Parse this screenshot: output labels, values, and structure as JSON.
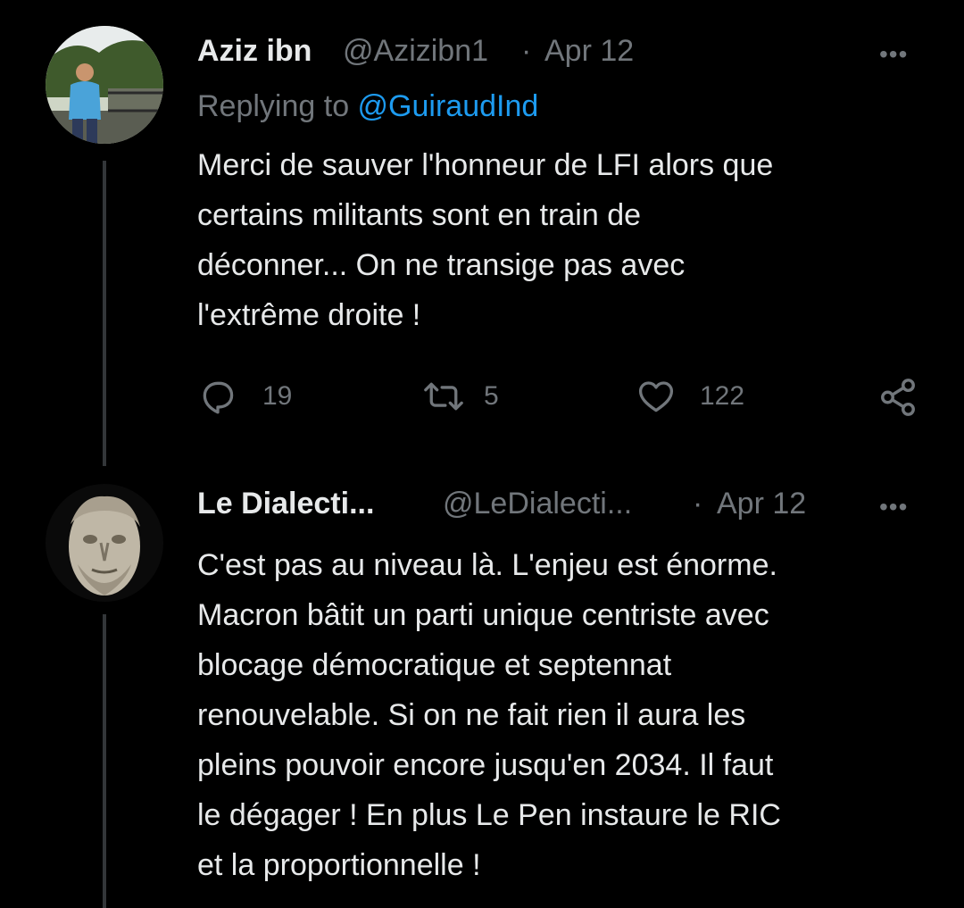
{
  "tweets": [
    {
      "name": "Aziz ibn",
      "handle": "@Azizibn1",
      "separator": "·",
      "date": "Apr 12",
      "more": "•••",
      "replying_prefix": "Replying to ",
      "replying_to": "@GuiraudInd",
      "text_lines": [
        "Merci de sauver l'honneur de LFI alors que",
        "certains militants sont en train de",
        "déconner... On ne transige pas avec",
        "l'extrême droite !"
      ],
      "actions": {
        "reply_icon": "reply-icon",
        "reply_count": "19",
        "retweet_icon": "retweet-icon",
        "retweet_count": "5",
        "like_icon": "heart-icon",
        "like_count": "122",
        "share_icon": "share-icon"
      }
    },
    {
      "name": "Le Dialecti...",
      "handle": "@LeDialecti...",
      "separator": "·",
      "date": "Apr 12",
      "more": "•••",
      "text_lines": [
        "C'est pas au niveau là. L'enjeu est énorme.",
        "Macron bâtit un parti unique centriste avec",
        "blocage démocratique et septennat",
        "renouvelable. Si on ne fait rien il aura les",
        "pleins pouvoir encore jusqu'en 2034. Il faut",
        "le dégager ! En plus Le Pen instaure le RIC",
        "et la proportionnelle !"
      ]
    }
  ],
  "colors": {
    "background": "#000000",
    "text": "#e7e9ea",
    "secondary": "#71767b",
    "link": "#1d9bf0",
    "thread_line": "#333639"
  }
}
